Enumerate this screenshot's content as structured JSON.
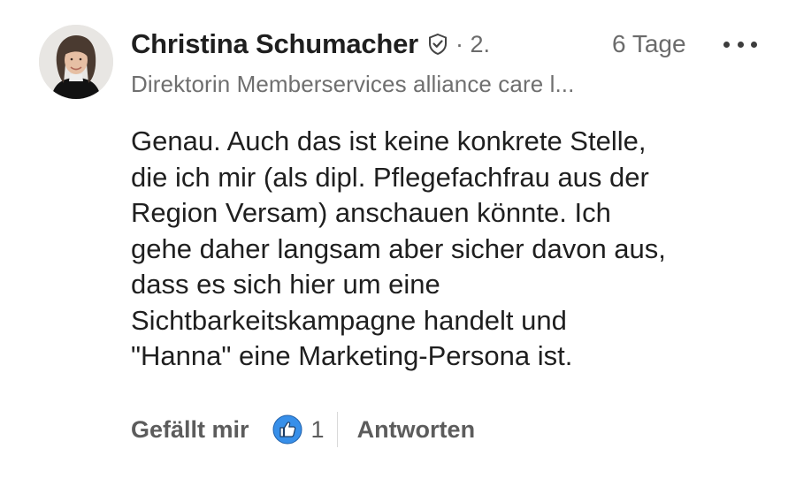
{
  "author": {
    "name": "Christina Schumacher",
    "degree": "· 2.",
    "time": "6 Tage",
    "headline": "Direktorin Memberservices alliance care l..."
  },
  "comment": {
    "lines": [
      "Genau. Auch das ist keine konkrete Stelle,",
      "die ich mir (als dipl. Pflegefachfrau aus der",
      "Region Versam) anschauen könnte. Ich",
      "gehe daher langsam aber sicher davon aus,",
      "dass es sich hier um eine",
      "Sichtbarkeitskampagne handelt und",
      "\"Hanna\" eine Marketing-Persona ist."
    ]
  },
  "actions": {
    "like_label": "Gefällt mir",
    "like_count": "1",
    "reply_label": "Antworten"
  },
  "icons": {
    "verified": "shield-check-icon",
    "more": "more-horizontal-icon",
    "like": "thumbs-up-icon"
  },
  "colors": {
    "like_blue": "#378fe9",
    "text_primary": "#1f1f1f",
    "text_secondary": "#6b6b6b"
  }
}
